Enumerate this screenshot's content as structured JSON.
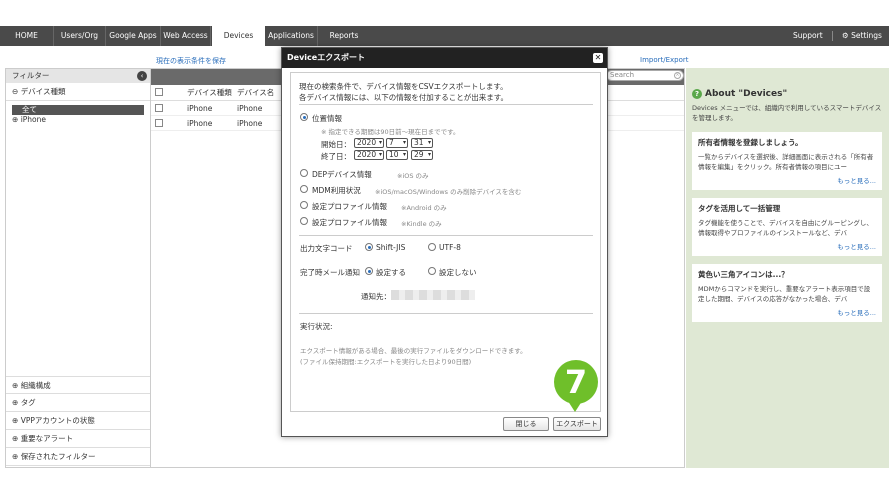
{
  "nav": {
    "tabs": [
      "HOME",
      "Users/Org",
      "Google Apps",
      "Web Access",
      "Devices",
      "Applications",
      "Reports"
    ],
    "support": "Support",
    "settings": "Settings"
  },
  "subbar": {
    "save_filter": "現在の表示条件を保存",
    "import_export": "Import/Export"
  },
  "filter": {
    "title": "フィルター",
    "device_type": "デバイス種類",
    "all": "全て",
    "iphone": "iPhone",
    "bottom": [
      "組織構成",
      "タグ",
      "VPPアカウントの状態",
      "重要なアラート",
      "保存されたフィルター"
    ]
  },
  "table": {
    "col1": "デバイス種類",
    "col2": "デバイス名",
    "rows": [
      {
        "type": "iPhone",
        "name": "iPhone"
      },
      {
        "type": "iPhone",
        "name": "iPhone"
      }
    ],
    "search_placeholder": "Search"
  },
  "about": {
    "title": "About \"Devices\"",
    "desc": "Devices メニューでは、組織内で利用しているスマートデバイスを管理します。",
    "cards": [
      {
        "title": "所有者情報を登録しましょう。",
        "text": "一覧からデバイスを選択後、詳細画面に表示される「所有者情報を編集」をクリック。所有者情報の項目にユー",
        "more": "もっと見る..."
      },
      {
        "title": "タグを活用して一括管理",
        "text": "タグ機能を使うことで、デバイスを自由にグルーピングし、情報取得やプロファイルのインストールなど、デバ",
        "more": "もっと見る..."
      },
      {
        "title": "黄色い三角アイコンは...？",
        "text": "MDMからコマンドを実行し、重要なアラート表示項目で設定した期間、デバイスの応答がなかった場合、デバ",
        "more": "もっと見る..."
      }
    ]
  },
  "modal": {
    "title": "Deviceエクスポート",
    "intro1": "現在の検索条件で、デバイス情報をCSVエクスポートします。",
    "intro2": "各デバイス情報には、以下の情報を付加することが出来ます。",
    "location": "位置情報",
    "period_note": "※ 指定できる期間は90日前〜現在日までです。",
    "start_label": "開始日：",
    "end_label": "終了日：",
    "start": {
      "y": "2020",
      "m": "7",
      "d": "31"
    },
    "end": {
      "y": "2020",
      "m": "10",
      "d": "29"
    },
    "options": [
      {
        "label": "DEPデバイス情報",
        "note": "※iOS のみ"
      },
      {
        "label": "MDM利用状況",
        "note": "※iOS/macOS/Windows のみ削除デバイスを含む"
      },
      {
        "label": "設定プロファイル情報",
        "note": "※Android のみ"
      },
      {
        "label": "設定プロファイル情報",
        "note": "※Kindle のみ"
      }
    ],
    "encoding_label": "出力文字コード",
    "enc_sjis": "Shift-JIS",
    "enc_utf8": "UTF-8",
    "mail_label": "完了時メール通知",
    "mail_on": "設定する",
    "mail_off": "設定しない",
    "notify_label": "通知先：",
    "status_label": "実行状況:",
    "status_note1": "エクスポート情報がある場合、最後の実行ファイルをダウンロードできます。",
    "status_note2": "(ファイル保持期間:エクスポートを実行した日より90日間)",
    "close_btn": "閉じる",
    "export_btn": "エクスポート"
  },
  "step_badge": "7",
  "colors": {
    "nav_bg": "#4a4a4a",
    "badge": "#6fbf2a",
    "about_bg": "#dfe8d4",
    "link": "#2a6ebb"
  }
}
